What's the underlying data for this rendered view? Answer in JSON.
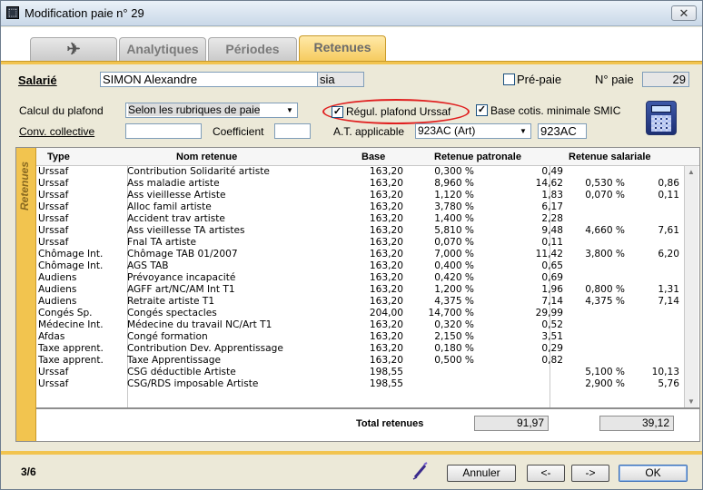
{
  "window": {
    "title": "Modification paie n° 29",
    "close_label": "✕"
  },
  "tabs": [
    {
      "label": "",
      "icon": "cadabra-icon"
    },
    {
      "label": "Analytiques"
    },
    {
      "label": "Périodes"
    },
    {
      "label": "Retenues"
    }
  ],
  "active_tab": "Retenues",
  "form": {
    "salarie_label": "Salarié",
    "salarie_name": "SIMON Alexandre",
    "salarie_code": "sia",
    "prepaie_label": "Pré-paie",
    "prepaie_checked": false,
    "npaie_label": "N° paie",
    "npaie_value": "29",
    "calcul_label": "Calcul du plafond",
    "calcul_value": "Selon les rubriques de paie",
    "regul_label": "Régul. plafond Urssaf",
    "regul_checked": true,
    "base_label": "Base cotis. minimale SMIC",
    "base_checked": true,
    "conv_label": "Conv. collective",
    "conv_value": "",
    "coef_label": "Coefficient",
    "coef_value": "",
    "at_label": "A.T. applicable",
    "at_select": "923AC (Art)",
    "at_code": "923AC"
  },
  "grid": {
    "sidebar_label": "Retenues",
    "headers": {
      "type": "Type",
      "nom": "Nom retenue",
      "base": "Base",
      "patronale": "Retenue patronale",
      "salariale": "Retenue salariale"
    },
    "rows": [
      {
        "type": "Urssaf",
        "nom": "Contribution Solidarité artiste",
        "base": "163,20",
        "pat_taux": "0,300 %",
        "pat_montant": "0,49",
        "sal_taux": "",
        "sal_montant": ""
      },
      {
        "type": "Urssaf",
        "nom": "Ass maladie artiste",
        "base": "163,20",
        "pat_taux": "8,960 %",
        "pat_montant": "14,62",
        "sal_taux": "0,530 %",
        "sal_montant": "0,86"
      },
      {
        "type": "Urssaf",
        "nom": "Ass vieillesse Artiste",
        "base": "163,20",
        "pat_taux": "1,120 %",
        "pat_montant": "1,83",
        "sal_taux": "0,070 %",
        "sal_montant": "0,11"
      },
      {
        "type": "Urssaf",
        "nom": "Alloc famil artiste",
        "base": "163,20",
        "pat_taux": "3,780 %",
        "pat_montant": "6,17",
        "sal_taux": "",
        "sal_montant": ""
      },
      {
        "type": "Urssaf",
        "nom": "Accident trav artiste",
        "base": "163,20",
        "pat_taux": "1,400 %",
        "pat_montant": "2,28",
        "sal_taux": "",
        "sal_montant": ""
      },
      {
        "type": "Urssaf",
        "nom": "Ass vieillesse TA artistes",
        "base": "163,20",
        "pat_taux": "5,810 %",
        "pat_montant": "9,48",
        "sal_taux": "4,660 %",
        "sal_montant": "7,61"
      },
      {
        "type": "Urssaf",
        "nom": "Fnal TA artiste",
        "base": "163,20",
        "pat_taux": "0,070 %",
        "pat_montant": "0,11",
        "sal_taux": "",
        "sal_montant": ""
      },
      {
        "type": "Chômage Int.",
        "nom": "Chômage TAB 01/2007",
        "base": "163,20",
        "pat_taux": "7,000 %",
        "pat_montant": "11,42",
        "sal_taux": "3,800 %",
        "sal_montant": "6,20"
      },
      {
        "type": "Chômage Int.",
        "nom": "AGS TAB",
        "base": "163,20",
        "pat_taux": "0,400 %",
        "pat_montant": "0,65",
        "sal_taux": "",
        "sal_montant": ""
      },
      {
        "type": "Audiens",
        "nom": "Prévoyance incapacité",
        "base": "163,20",
        "pat_taux": "0,420 %",
        "pat_montant": "0,69",
        "sal_taux": "",
        "sal_montant": ""
      },
      {
        "type": "Audiens",
        "nom": "AGFF art/NC/AM Int T1",
        "base": "163,20",
        "pat_taux": "1,200 %",
        "pat_montant": "1,96",
        "sal_taux": "0,800 %",
        "sal_montant": "1,31"
      },
      {
        "type": "Audiens",
        "nom": "Retraite artiste T1",
        "base": "163,20",
        "pat_taux": "4,375 %",
        "pat_montant": "7,14",
        "sal_taux": "4,375 %",
        "sal_montant": "7,14"
      },
      {
        "type": "Congés Sp.",
        "nom": "Congés spectacles",
        "base": "204,00",
        "pat_taux": "14,700 %",
        "pat_montant": "29,99",
        "sal_taux": "",
        "sal_montant": ""
      },
      {
        "type": "Médecine Int.",
        "nom": "Médecine du travail NC/Art T1",
        "base": "163,20",
        "pat_taux": "0,320 %",
        "pat_montant": "0,52",
        "sal_taux": "",
        "sal_montant": ""
      },
      {
        "type": "Afdas",
        "nom": "Congé formation",
        "base": "163,20",
        "pat_taux": "2,150 %",
        "pat_montant": "3,51",
        "sal_taux": "",
        "sal_montant": ""
      },
      {
        "type": "Taxe apprent.",
        "nom": "Contribution Dev. Apprentissage",
        "base": "163,20",
        "pat_taux": "0,180 %",
        "pat_montant": "0,29",
        "sal_taux": "",
        "sal_montant": ""
      },
      {
        "type": "Taxe apprent.",
        "nom": "Taxe Apprentissage",
        "base": "163,20",
        "pat_taux": "0,500 %",
        "pat_montant": "0,82",
        "sal_taux": "",
        "sal_montant": ""
      },
      {
        "type": "Urssaf",
        "nom": "CSG déductible Artiste",
        "base": "198,55",
        "pat_taux": "",
        "pat_montant": "",
        "sal_taux": "5,100 %",
        "sal_montant": "10,13"
      },
      {
        "type": "Urssaf",
        "nom": "CSG/RDS imposable Artiste",
        "base": "198,55",
        "pat_taux": "",
        "pat_montant": "",
        "sal_taux": "2,900 %",
        "sal_montant": "5,76"
      }
    ],
    "total_label": "Total retenues",
    "total_patronale": "91,97",
    "total_salariale": "39,12"
  },
  "footer": {
    "page_indicator": "3/6",
    "annuler_label": "Annuler",
    "prev_label": "<-",
    "next_label": "->",
    "ok_label": "OK"
  }
}
